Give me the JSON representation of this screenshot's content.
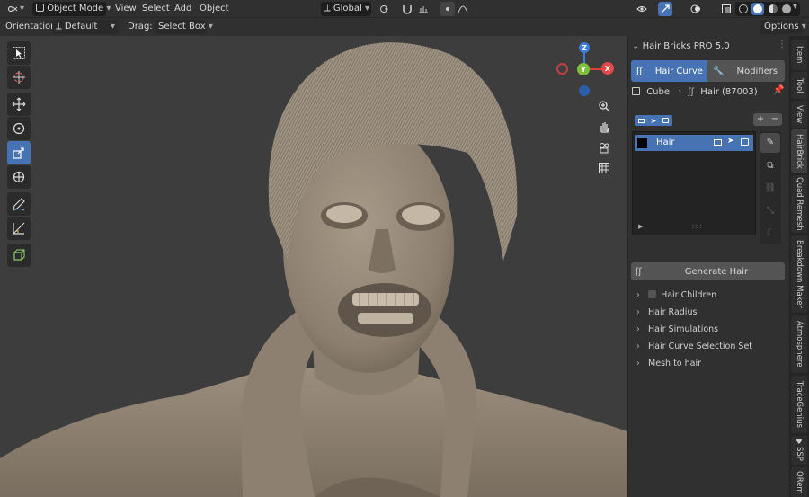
{
  "header": {
    "mode": "Object Mode",
    "menus": [
      "View",
      "Select",
      "Add",
      "Object"
    ],
    "transform_orientation": "Global"
  },
  "toolbar2": {
    "orientation_label": "Orientation:",
    "orientation_value": "Default",
    "drag_label": "Drag:",
    "drag_value": "Select Box",
    "options_label": "Options"
  },
  "gizmo": {
    "z": "Z",
    "y": "Y",
    "x": "X"
  },
  "panel": {
    "title": "Hair Bricks PRO 5.0",
    "tab_hair_curve": "Hair Curve",
    "tab_modifiers": "Modifiers",
    "object_name": "Cube",
    "hair_object": "Hair (87003)",
    "list_item": "Hair",
    "generate_button": "Generate Hair",
    "sections": [
      "Hair Children",
      "Hair Radius",
      "Hair Simulations",
      "Hair Curve Selection Set",
      "Mesh to hair"
    ]
  },
  "sidebar_tabs": [
    "Item",
    "Tool",
    "View",
    "HairBrick",
    "Quad Remesh",
    "Breakdown Maker",
    "Atmosphere",
    "TraceGenius",
    "SSP",
    "QRem"
  ],
  "colors": {
    "accent": "#4772b3",
    "background": "#3d3d3d",
    "panel": "#303030",
    "sculpt": "#8f8271"
  }
}
